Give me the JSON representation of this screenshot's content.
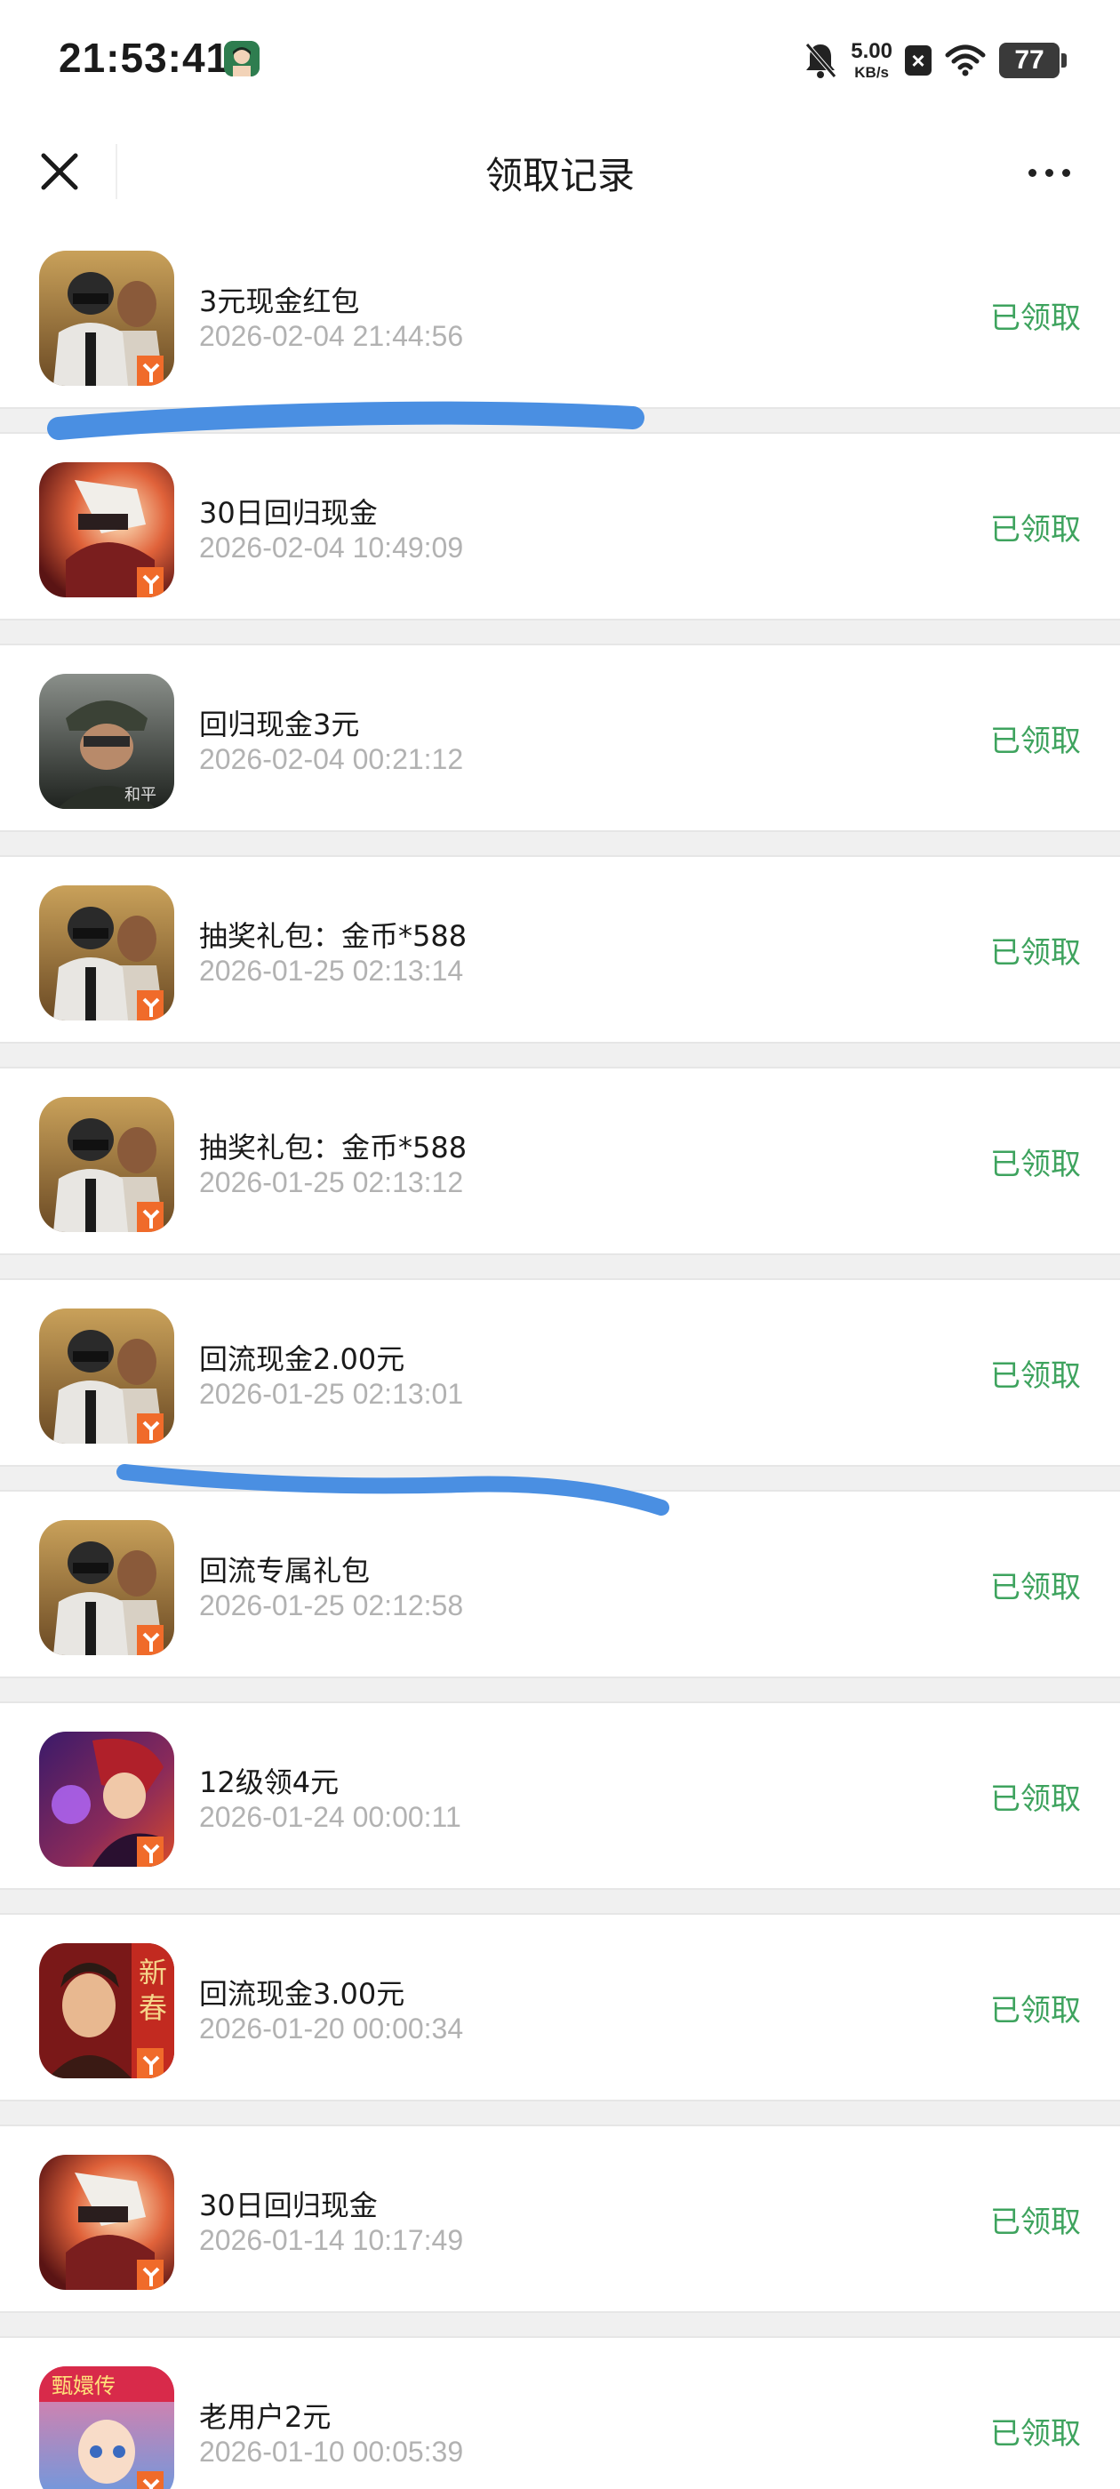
{
  "status_bar": {
    "time": "21:53:41",
    "net_speed_value": "5.00",
    "net_speed_unit": "KB/s",
    "battery": "77",
    "icons": [
      "bell-muted-icon",
      "close-box-icon",
      "wifi-icon",
      "battery-icon"
    ]
  },
  "nav": {
    "title": "领取记录",
    "close_icon": "close-icon",
    "more_icon": "more-dots-icon"
  },
  "colors": {
    "status_green": "#3ea35e",
    "time_gray": "#b2b2b2",
    "separator": "#f0f0f0",
    "highlighter_blue": "#4a8fe2"
  },
  "records": [
    {
      "title": "3元现金红包",
      "time": "2026-02-04 21:44:56",
      "status": "已领取",
      "icon": "game-icon-pubg"
    },
    {
      "title": "30日回归现金",
      "time": "2026-02-04 10:49:09",
      "status": "已领取",
      "icon": "game-icon-dnf"
    },
    {
      "title": "回归现金3元",
      "time": "2026-02-04 00:21:12",
      "status": "已领取",
      "icon": "game-icon-soldier"
    },
    {
      "title": "抽奖礼包：金币*588",
      "time": "2026-01-25 02:13:14",
      "status": "已领取",
      "icon": "game-icon-pubg"
    },
    {
      "title": "抽奖礼包：金币*588",
      "time": "2026-01-25 02:13:12",
      "status": "已领取",
      "icon": "game-icon-pubg"
    },
    {
      "title": "回流现金2.00元",
      "time": "2026-01-25 02:13:01",
      "status": "已领取",
      "icon": "game-icon-pubg"
    },
    {
      "title": "回流专属礼包",
      "time": "2026-01-25 02:12:58",
      "status": "已领取",
      "icon": "game-icon-pubg"
    },
    {
      "title": "12级领4元",
      "time": "2026-01-24 00:00:11",
      "status": "已领取",
      "icon": "game-icon-kof"
    },
    {
      "title": "回流现金3.00元",
      "time": "2026-01-20 00:00:34",
      "status": "已领取",
      "icon": "game-icon-xinchun"
    },
    {
      "title": "30日回归现金",
      "time": "2026-01-14 10:17:49",
      "status": "已领取",
      "icon": "game-icon-dnf"
    },
    {
      "title": "老用户2元",
      "time": "2026-01-10 00:05:39",
      "status": "已领取",
      "icon": "game-icon-anime"
    }
  ]
}
